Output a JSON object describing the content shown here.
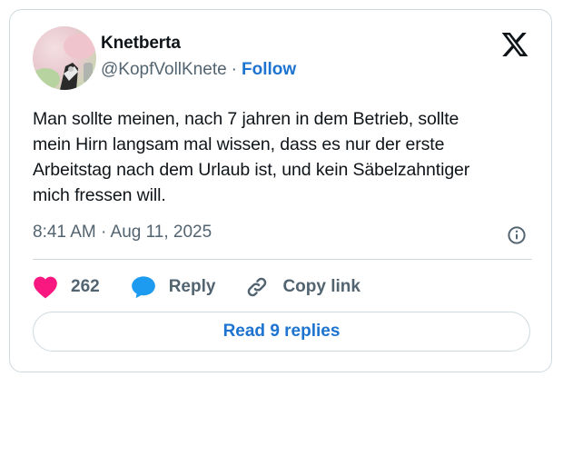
{
  "author": {
    "name": "Knetberta",
    "handle": "@KopfVollKnete",
    "separator": "·",
    "follow_label": "Follow"
  },
  "tweet": {
    "text": "Man sollte meinen, nach 7 jahren in dem Betrieb, sollte\nmein Hirn langsam mal wissen, dass es nur der erste\nArbeitstag nach dem Urlaub ist, und kein Säbelzahntiger\nmich fressen will.",
    "timestamp": "8:41 AM · Aug 11, 2025"
  },
  "actions": {
    "like_count": "262",
    "reply_label": "Reply",
    "copy_link_label": "Copy link"
  },
  "read_replies_label": "Read 9 replies",
  "colors": {
    "link_blue": "#1d74d0",
    "heart_pink": "#f91880",
    "reply_blue": "#1d9bf0",
    "muted_text": "#536471",
    "border": "#cfd9de"
  },
  "icons": {
    "platform_logo": "x-logo-icon",
    "info": "info-icon",
    "like": "heart-icon",
    "reply": "speech-bubble-icon",
    "copy_link": "link-icon"
  }
}
